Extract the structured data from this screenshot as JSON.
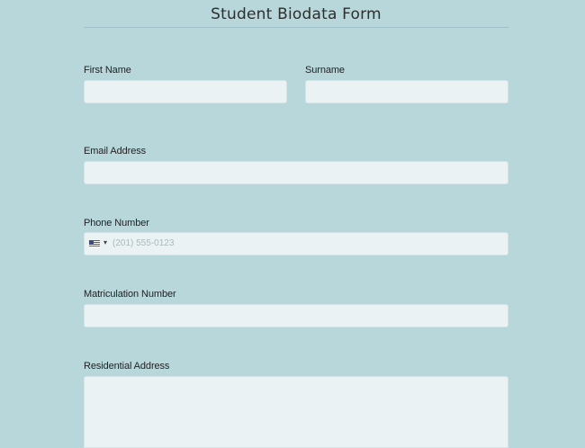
{
  "form": {
    "title": "Student Biodata Form",
    "fields": {
      "first_name": {
        "label": "First Name",
        "value": ""
      },
      "surname": {
        "label": "Surname",
        "value": ""
      },
      "email": {
        "label": "Email Address",
        "value": ""
      },
      "phone": {
        "label": "Phone Number",
        "country_flag": "us-flag-icon",
        "placeholder": "(201) 555-0123",
        "value": ""
      },
      "matriculation": {
        "label": "Matriculation Number",
        "value": ""
      },
      "address": {
        "label": "Residential Address",
        "value": ""
      }
    }
  },
  "colors": {
    "background": "#b8d7db",
    "input_background": "#ebf2f4",
    "text": "#2a2a2a"
  }
}
